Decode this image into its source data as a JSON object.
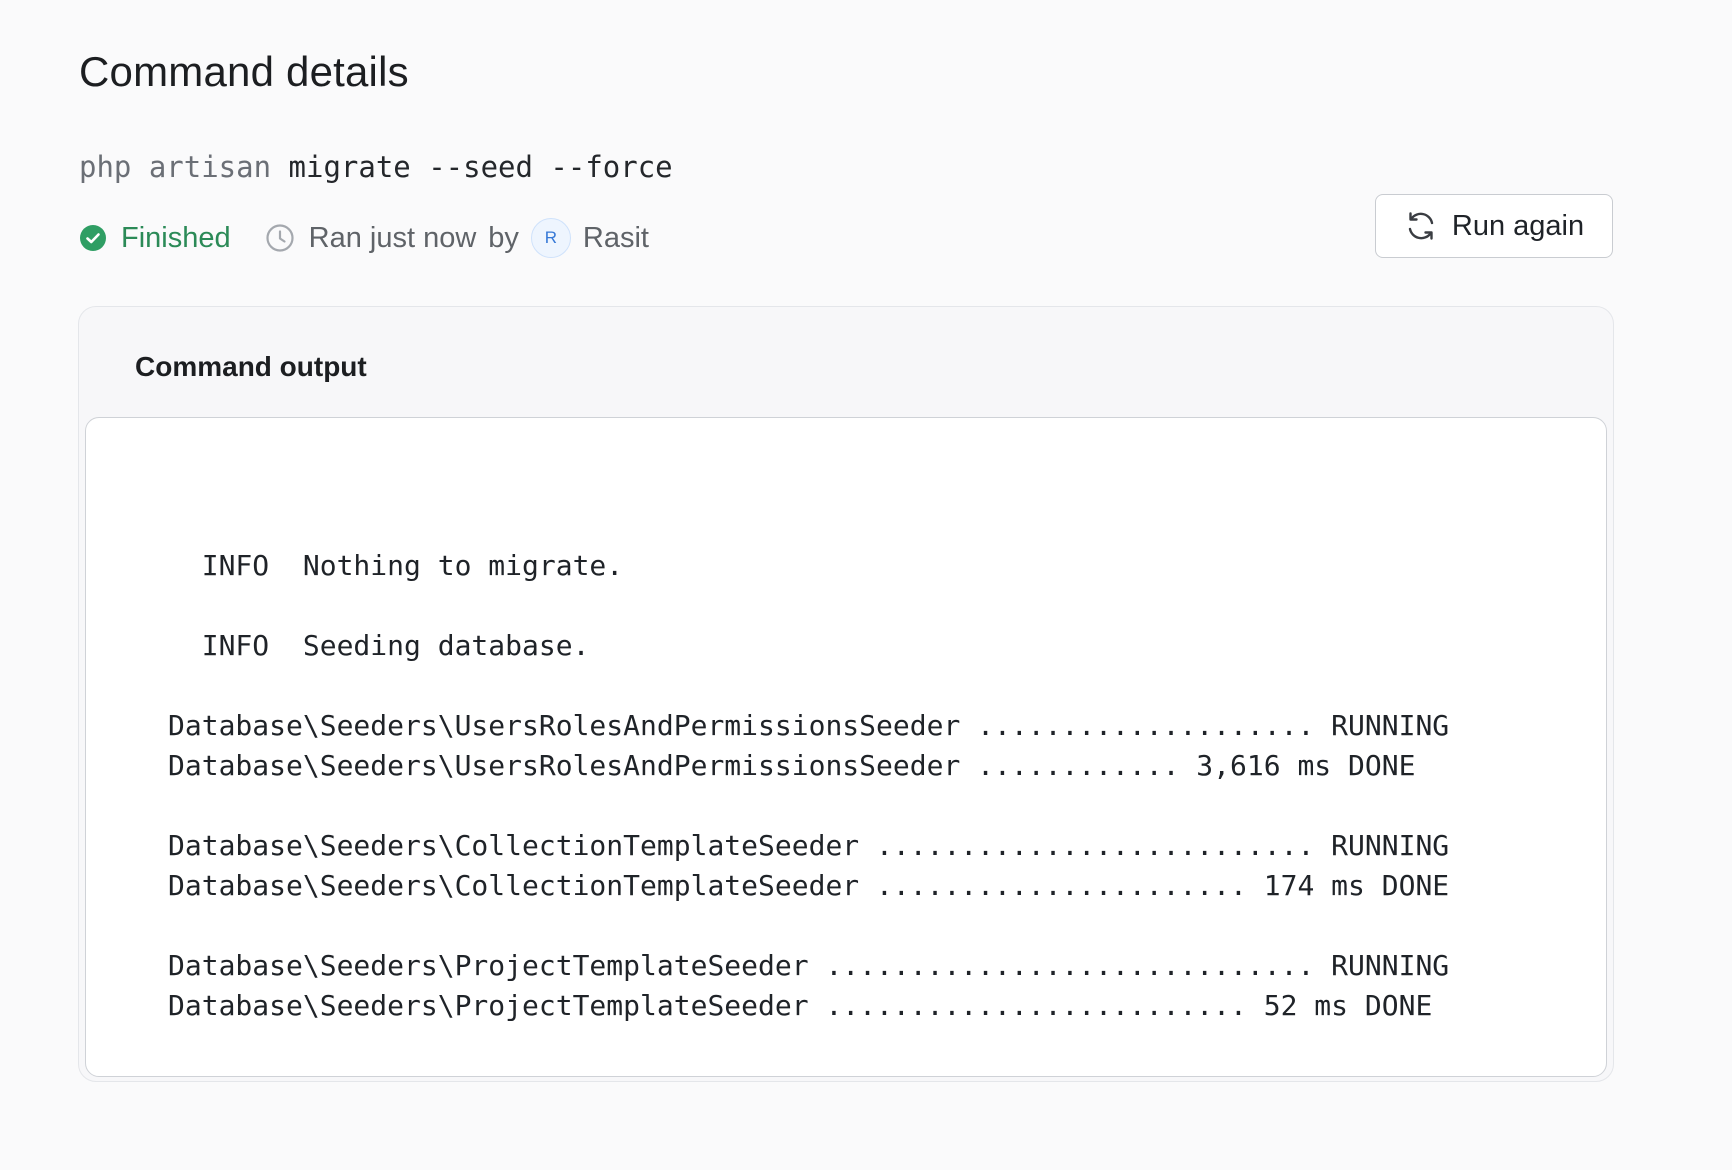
{
  "header": {
    "title": "Command details"
  },
  "command": {
    "prefix": "php artisan",
    "args": "migrate --seed --force"
  },
  "meta": {
    "status": "Finished",
    "status_color": "#2b8a57",
    "ran_text": "Ran just now",
    "by_text": "by",
    "user_initial": "R",
    "user_name": "Rasit"
  },
  "actions": {
    "run_again_label": "Run again"
  },
  "output": {
    "title": "Command output",
    "lines": [
      "",
      "  INFO  Nothing to migrate.",
      "",
      "  INFO  Seeding database.",
      "",
      "Database\\Seeders\\UsersRolesAndPermissionsSeeder .................... RUNNING",
      "Database\\Seeders\\UsersRolesAndPermissionsSeeder ............ 3,616 ms DONE",
      "",
      "Database\\Seeders\\CollectionTemplateSeeder .......................... RUNNING",
      "Database\\Seeders\\CollectionTemplateSeeder ...................... 174 ms DONE",
      "",
      "Database\\Seeders\\ProjectTemplateSeeder ............................. RUNNING",
      "Database\\Seeders\\ProjectTemplateSeeder ......................... 52 ms DONE"
    ]
  },
  "icons": {
    "status": "check-circle-icon",
    "time": "clock-icon",
    "run_again": "refresh-icon"
  }
}
